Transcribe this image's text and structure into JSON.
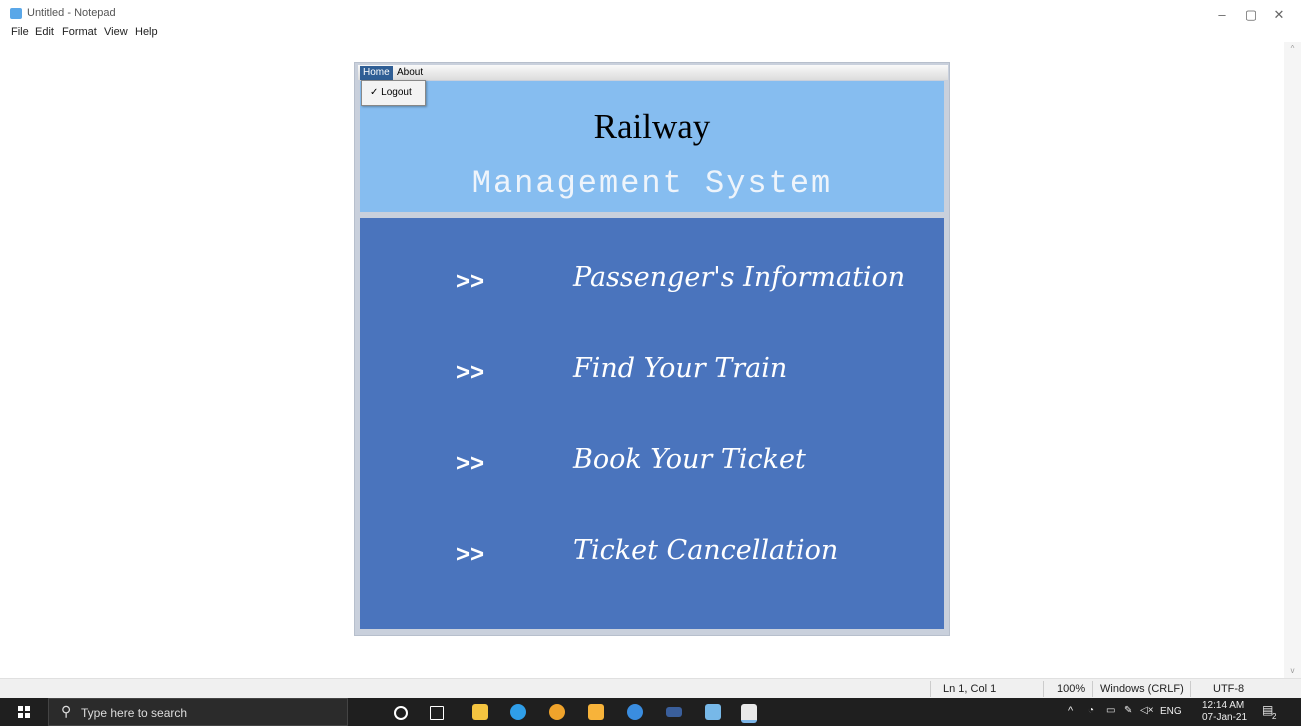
{
  "notepad": {
    "title": "Untitled - Notepad",
    "menu": [
      "File",
      "Edit",
      "Format",
      "View",
      "Help"
    ],
    "status": {
      "position": "Ln 1, Col 1",
      "zoom": "100%",
      "line_endings": "Windows (CRLF)",
      "encoding": "UTF-8"
    },
    "controls": {
      "minimize": "–",
      "maximize": "▢",
      "close": "✕"
    }
  },
  "app": {
    "menu": {
      "home": "Home",
      "about": "About"
    },
    "dropdown": {
      "logout": "✓ Logout"
    },
    "header": {
      "title": "Railway",
      "subtitle": "Management System"
    },
    "items": [
      {
        "arrow": ">>",
        "label": "Passenger's Information"
      },
      {
        "arrow": ">>",
        "label": "Find Your Train"
      },
      {
        "arrow": ">>",
        "label": "Book Your Ticket"
      },
      {
        "arrow": ">>",
        "label": "Ticket Cancellation"
      }
    ],
    "colors": {
      "header_bg": "#86bdf0",
      "content_bg": "#4a74bd",
      "menu_active": "#2f5e95"
    }
  },
  "taskbar": {
    "search_placeholder": "Type here to search",
    "time": "12:14 AM",
    "date": "07-Jan-21",
    "lang": "ENG",
    "notification_count": "2",
    "pinned_icons": [
      "cortana-icon",
      "task-view-icon",
      "file-explorer-icon",
      "edge-icon",
      "chrome-icon",
      "store-icon",
      "app-icon",
      "media-icon",
      "notepad-icon",
      "java-icon"
    ]
  }
}
